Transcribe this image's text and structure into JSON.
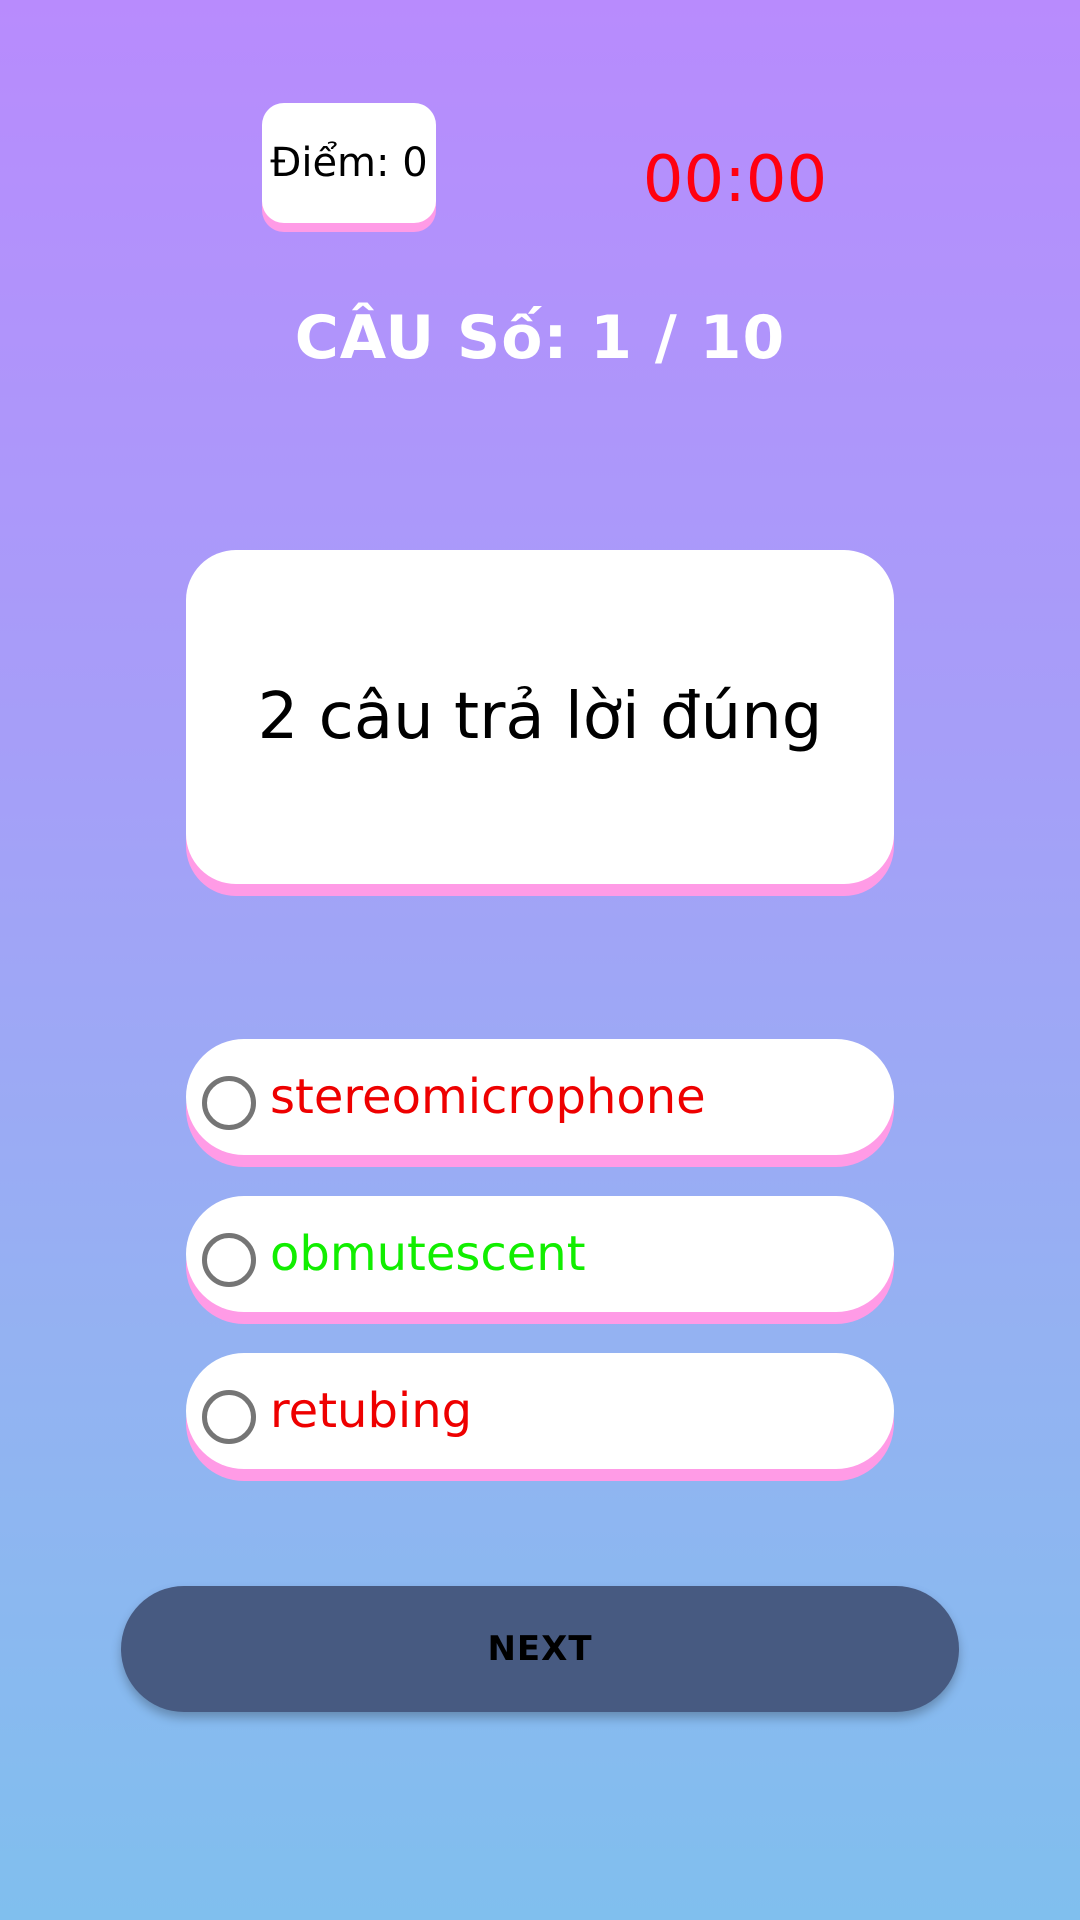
{
  "header": {
    "score_label": "Điểm: 0",
    "timer": "00:00",
    "question_counter": "CÂU Số: 1 / 10"
  },
  "question": {
    "text": "2 câu trả lời đúng"
  },
  "options": [
    {
      "label": "stereomicrophone",
      "color": "#ee0000",
      "selected": false
    },
    {
      "label": "obmutescent",
      "color": "#11ee00",
      "selected": false
    },
    {
      "label": "retubing",
      "color": "#ee0000",
      "selected": false
    }
  ],
  "actions": {
    "next_label": "NEXT"
  },
  "colors": {
    "card_shadow": "#ff9be6",
    "timer": "#ff0010",
    "next_button": "#475a81"
  }
}
